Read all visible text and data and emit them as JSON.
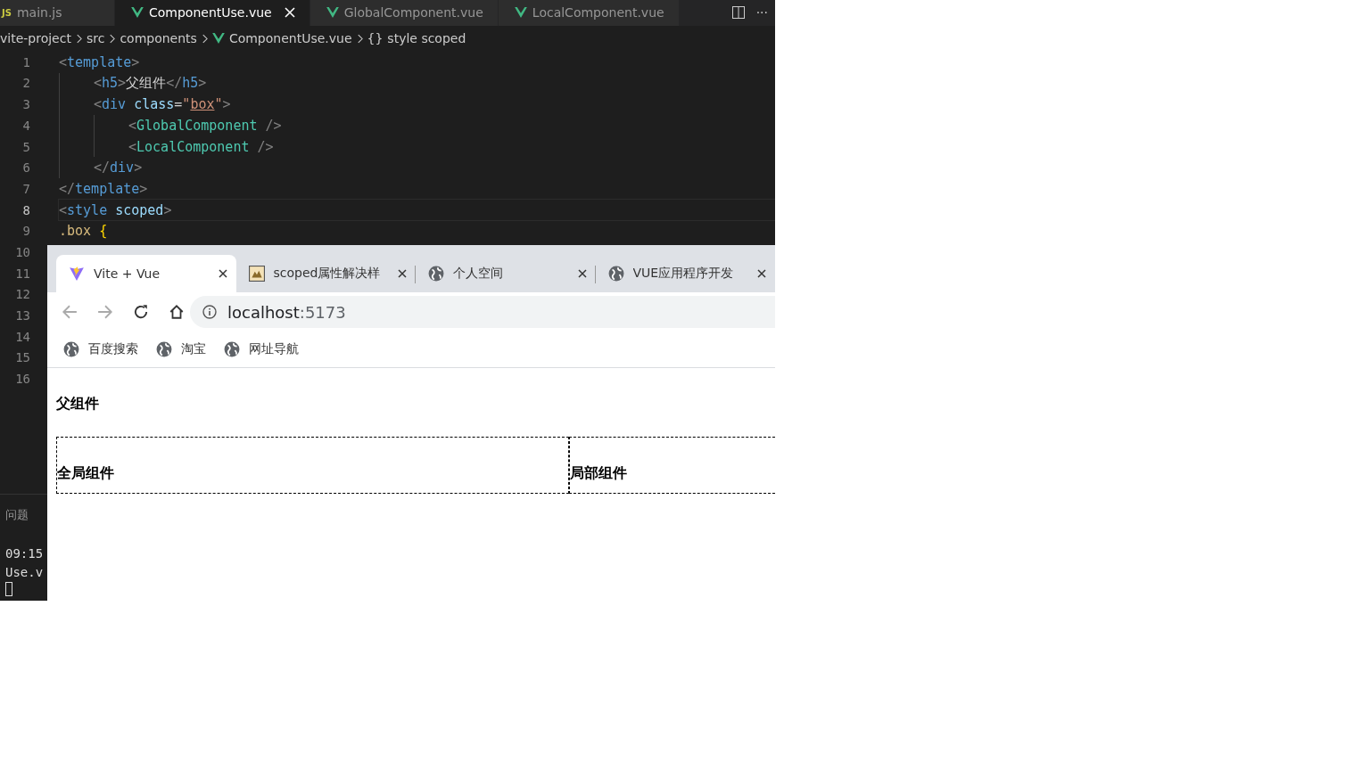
{
  "editor": {
    "tabs": [
      {
        "label": "main.js",
        "kind": "js",
        "badge": "JS",
        "selected": false,
        "closable": false
      },
      {
        "label": "ComponentUse.vue",
        "kind": "vue",
        "selected": true,
        "closable": true
      },
      {
        "label": "GlobalComponent.vue",
        "kind": "vue",
        "selected": false,
        "closable": false
      },
      {
        "label": "LocalComponent.vue",
        "kind": "vue",
        "selected": false,
        "closable": false
      }
    ],
    "more": "···",
    "breadcrumb": [
      {
        "label": "vite-project",
        "kind": "folder"
      },
      {
        "label": "src",
        "kind": "folder"
      },
      {
        "label": "components",
        "kind": "folder"
      },
      {
        "label": "ComponentUse.vue",
        "kind": "vue"
      },
      {
        "label": "style scoped",
        "kind": "symbol",
        "icon_text": "{}"
      }
    ],
    "gutter": [
      {
        "number": "1",
        "current": false
      },
      {
        "number": "2",
        "current": false
      },
      {
        "number": "3",
        "current": false
      },
      {
        "number": "4",
        "current": false
      },
      {
        "number": "5",
        "current": false
      },
      {
        "number": "6",
        "current": false
      },
      {
        "number": "7",
        "current": false
      },
      {
        "number": "8",
        "current": true
      },
      {
        "number": "9",
        "current": false
      },
      {
        "number": "10",
        "current": false
      },
      {
        "number": "11",
        "current": false
      },
      {
        "number": "12",
        "current": false
      },
      {
        "number": "13",
        "current": false
      },
      {
        "number": "14",
        "current": false
      },
      {
        "number": "15",
        "current": false
      },
      {
        "number": "16",
        "current": false
      }
    ],
    "code": [
      {
        "tokens": [
          {
            "kind": "punct",
            "text": "<"
          },
          {
            "kind": "tag",
            "text": "template"
          },
          {
            "kind": "punct",
            "text": ">"
          }
        ],
        "children": [
          {
            "tokens": [
              {
                "kind": "punct",
                "text": "<"
              },
              {
                "kind": "tag",
                "text": "h5"
              },
              {
                "kind": "punct",
                "text": ">"
              },
              {
                "kind": "text",
                "text": "父组件"
              },
              {
                "kind": "punct",
                "text": "</"
              },
              {
                "kind": "tag",
                "text": "h5"
              },
              {
                "kind": "punct",
                "text": ">"
              }
            ]
          },
          {
            "tokens": [
              {
                "kind": "punct",
                "text": "<"
              },
              {
                "kind": "tag",
                "text": "div "
              },
              {
                "kind": "attr",
                "text": "class"
              },
              {
                "kind": "text",
                "text": "="
              },
              {
                "kind": "string",
                "text": "\""
              },
              {
                "kind": "underlined",
                "text": "box"
              },
              {
                "kind": "string",
                "text": "\""
              },
              {
                "kind": "punct",
                "text": ">"
              }
            ],
            "children": [
              {
                "tokens": [
                  {
                    "kind": "punct",
                    "text": "<"
                  },
                  {
                    "kind": "component",
                    "text": "GlobalComponent"
                  },
                  {
                    "kind": "punct",
                    "text": " />"
                  }
                ]
              },
              {
                "tokens": [
                  {
                    "kind": "punct",
                    "text": "<"
                  },
                  {
                    "kind": "component",
                    "text": "LocalComponent"
                  },
                  {
                    "kind": "punct",
                    "text": " />"
                  }
                ]
              }
            ]
          },
          {
            "tokens": [
              {
                "kind": "punct",
                "text": "</"
              },
              {
                "kind": "tag",
                "text": "div"
              },
              {
                "kind": "punct",
                "text": ">"
              }
            ]
          }
        ]
      },
      {
        "tokens": [
          {
            "kind": "punct",
            "text": "</"
          },
          {
            "kind": "tag",
            "text": "template"
          },
          {
            "kind": "punct",
            "text": ">"
          }
        ]
      },
      {
        "tokens": [
          {
            "kind": "punct",
            "text": "<"
          },
          {
            "kind": "tag",
            "text": "style "
          },
          {
            "kind": "attr",
            "text": "scoped"
          },
          {
            "kind": "punct",
            "text": ">"
          }
        ]
      },
      {
        "tokens": [
          {
            "kind": "selector",
            "text": ".box "
          },
          {
            "kind": "brace",
            "text": "{"
          }
        ]
      }
    ],
    "panel": {
      "title": "问题",
      "terminal": [
        "09:15",
        "Use.v"
      ]
    }
  },
  "browser": {
    "tabs": [
      {
        "label": "Vite + Vue",
        "kind": "vite",
        "selected": true
      },
      {
        "label": "scoped属性解决样",
        "kind": "image",
        "selected": false
      },
      {
        "label": "个人空间",
        "kind": "globe",
        "selected": false
      },
      {
        "label": "VUE应用程序开发",
        "kind": "globe",
        "selected": false
      }
    ],
    "address": {
      "host": "localhost",
      "port": ":5173"
    },
    "bookmarks": [
      "百度搜索",
      "淘宝",
      "网址导航"
    ],
    "page": {
      "heading": "父组件",
      "children": [
        "全局组件",
        "局部组件"
      ]
    }
  }
}
